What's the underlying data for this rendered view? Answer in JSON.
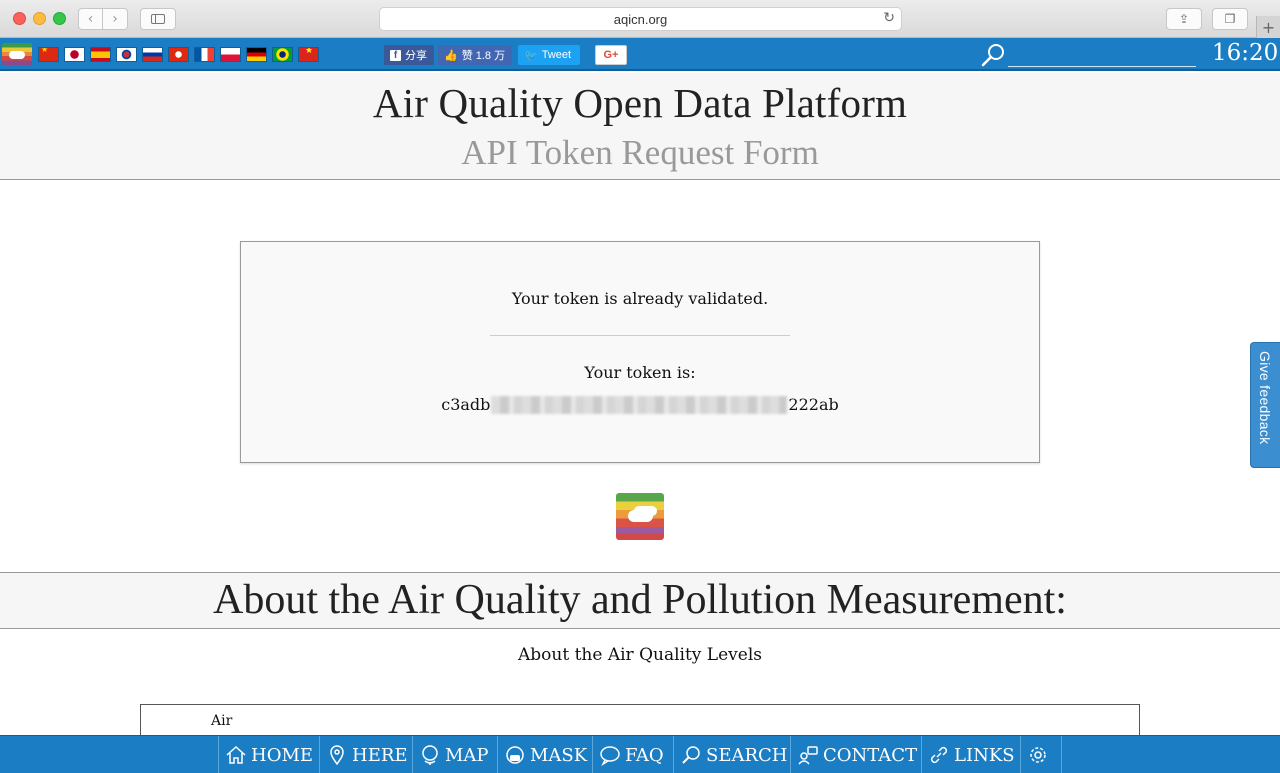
{
  "browser": {
    "url": "aqicn.org",
    "back_icon": "‹",
    "forward_icon": "›",
    "reload_icon": "↻",
    "share_icon": "⇪",
    "tabs_icon": "❐",
    "newtab_icon": "+"
  },
  "topbar": {
    "flags": [
      "home",
      "cn",
      "jp",
      "es",
      "kr",
      "ru",
      "hk",
      "fr",
      "pl",
      "de",
      "br",
      "vn"
    ],
    "social": {
      "fb_share": "分享",
      "fb_like": "赞 1.8 万",
      "tweet": "Tweet",
      "gplus": "G+"
    },
    "search_placeholder": "",
    "clock": "16:20"
  },
  "header": {
    "site_title": "Air Quality Open Data Platform",
    "form_title": "API Token Request Form"
  },
  "token": {
    "validated_message": "Your token is already validated.",
    "label": "Your token is:",
    "prefix": "c3adb",
    "suffix": "222ab"
  },
  "about": {
    "title": "About the Air Quality and Pollution Measurement:",
    "levels_heading": "About the Air Quality Levels",
    "table_first_header": "Air"
  },
  "feedback": {
    "label": "Give feedback"
  },
  "bottom_nav": {
    "home": "HOME",
    "here": "HERE",
    "map": "MAP",
    "mask": "MASK",
    "faq": "FAQ",
    "search": "SEARCH",
    "contact": "CONTACT",
    "links": "LINKS"
  },
  "colors": {
    "bar_blue": "#1b7dc3",
    "header_bg": "#f6f6f6",
    "feedback_blue": "#3b8ed0"
  }
}
